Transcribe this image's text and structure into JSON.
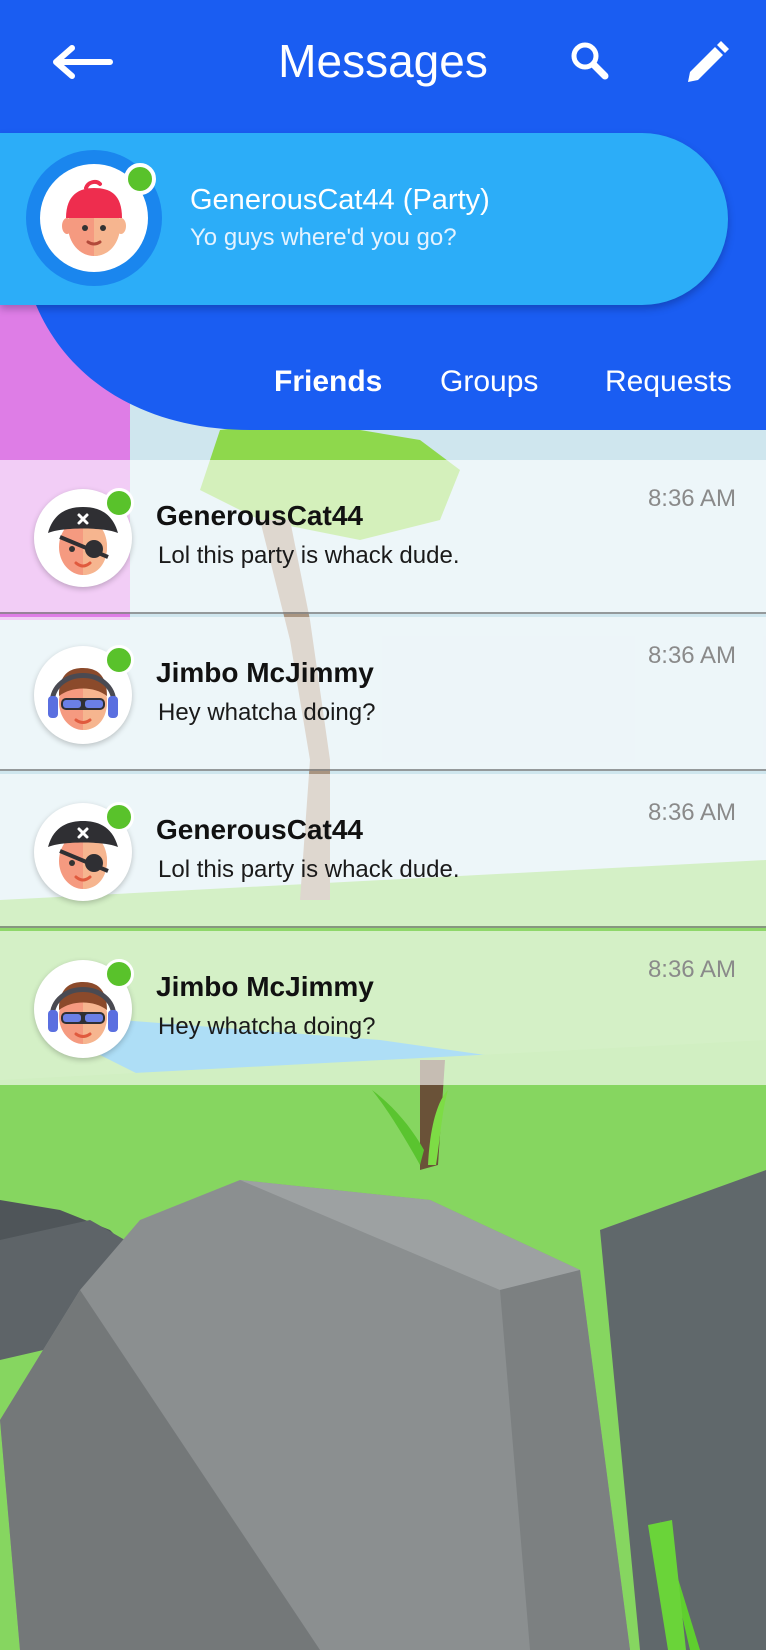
{
  "header": {
    "title": "Messages",
    "back_icon": "arrow-left-icon",
    "search_icon": "search-icon",
    "edit_icon": "pencil-icon",
    "bg_color": "#1a5df2"
  },
  "party": {
    "name": "GenerousCat44 (Party)",
    "message": "Yo guys where'd you go?",
    "avatar_icon": "red-cap-avatar-icon",
    "online": true,
    "card_color": "#2cadf8"
  },
  "tabs": [
    {
      "label": "Friends",
      "active": true
    },
    {
      "label": "Groups",
      "active": false
    },
    {
      "label": "Requests",
      "active": false
    }
  ],
  "conversations": [
    {
      "name": "GenerousCat44",
      "message": "Lol this party is whack dude.",
      "time": "8:36 AM",
      "avatar_icon": "pirate-avatar-icon",
      "online": true
    },
    {
      "name": "Jimbo McJimmy",
      "message": "Hey whatcha doing?",
      "time": "8:36 AM",
      "avatar_icon": "headphones-avatar-icon",
      "online": true
    },
    {
      "name": "GenerousCat44",
      "message": "Lol this party is whack dude.",
      "time": "8:36 AM",
      "avatar_icon": "pirate-avatar-icon",
      "online": true
    },
    {
      "name": "Jimbo McJimmy",
      "message": "Hey whatcha doing?",
      "time": "8:36 AM",
      "avatar_icon": "headphones-avatar-icon",
      "online": true
    }
  ],
  "colors": {
    "online": "#59c22b",
    "primary": "#1a5df2",
    "accent": "#2cadf8"
  }
}
